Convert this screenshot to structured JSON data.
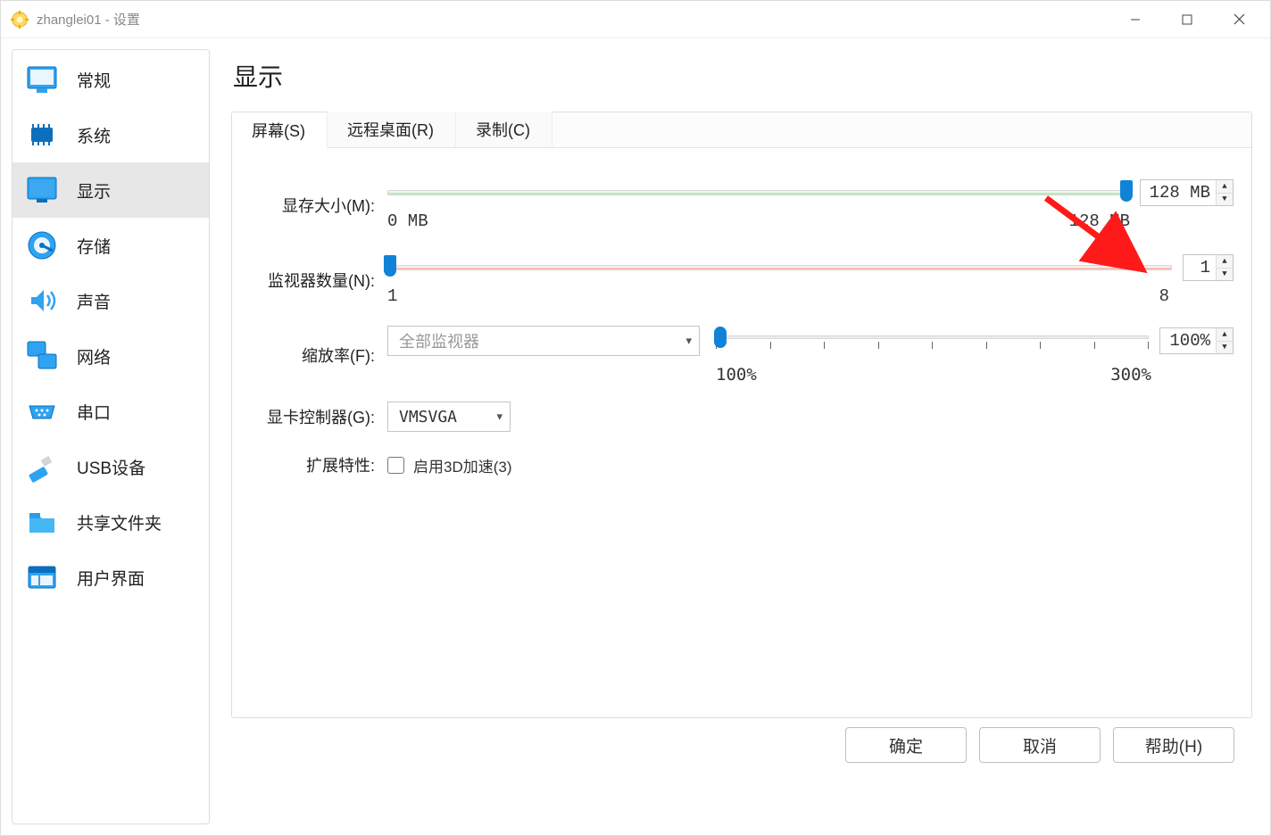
{
  "title": "zhanglei01 - 设置",
  "sidebar": {
    "items": [
      {
        "label": "常规",
        "icon": "general-icon"
      },
      {
        "label": "系统",
        "icon": "system-icon"
      },
      {
        "label": "显示",
        "icon": "display-icon"
      },
      {
        "label": "存储",
        "icon": "storage-icon"
      },
      {
        "label": "声音",
        "icon": "audio-icon"
      },
      {
        "label": "网络",
        "icon": "network-icon"
      },
      {
        "label": "串口",
        "icon": "serial-icon"
      },
      {
        "label": "USB设备",
        "icon": "usb-icon"
      },
      {
        "label": "共享文件夹",
        "icon": "shared-folder-icon"
      },
      {
        "label": "用户界面",
        "icon": "ui-icon"
      }
    ],
    "selected_index": 2
  },
  "page": {
    "title": "显示",
    "tabs": [
      "屏幕(S)",
      "远程桌面(R)",
      "录制(C)"
    ],
    "active_tab": 0
  },
  "fields": {
    "vram": {
      "label": "显存大小(M):",
      "min_label": "0 MB",
      "max_label": "128 MB",
      "value": "128 MB"
    },
    "monitors": {
      "label": "监视器数量(N):",
      "min_label": "1",
      "max_label": "8",
      "value": "1"
    },
    "scale": {
      "label": "缩放率(F):",
      "dropdown": "全部监视器",
      "min_label": "100%",
      "max_label": "300%",
      "value": "100%"
    },
    "controller": {
      "label": "显卡控制器(G):",
      "value": "VMSVGA"
    },
    "extfeatures": {
      "label": "扩展特性:",
      "checkbox_label": "启用3D加速(3)"
    }
  },
  "footer": {
    "ok": "确定",
    "cancel": "取消",
    "help": "帮助(H)"
  }
}
